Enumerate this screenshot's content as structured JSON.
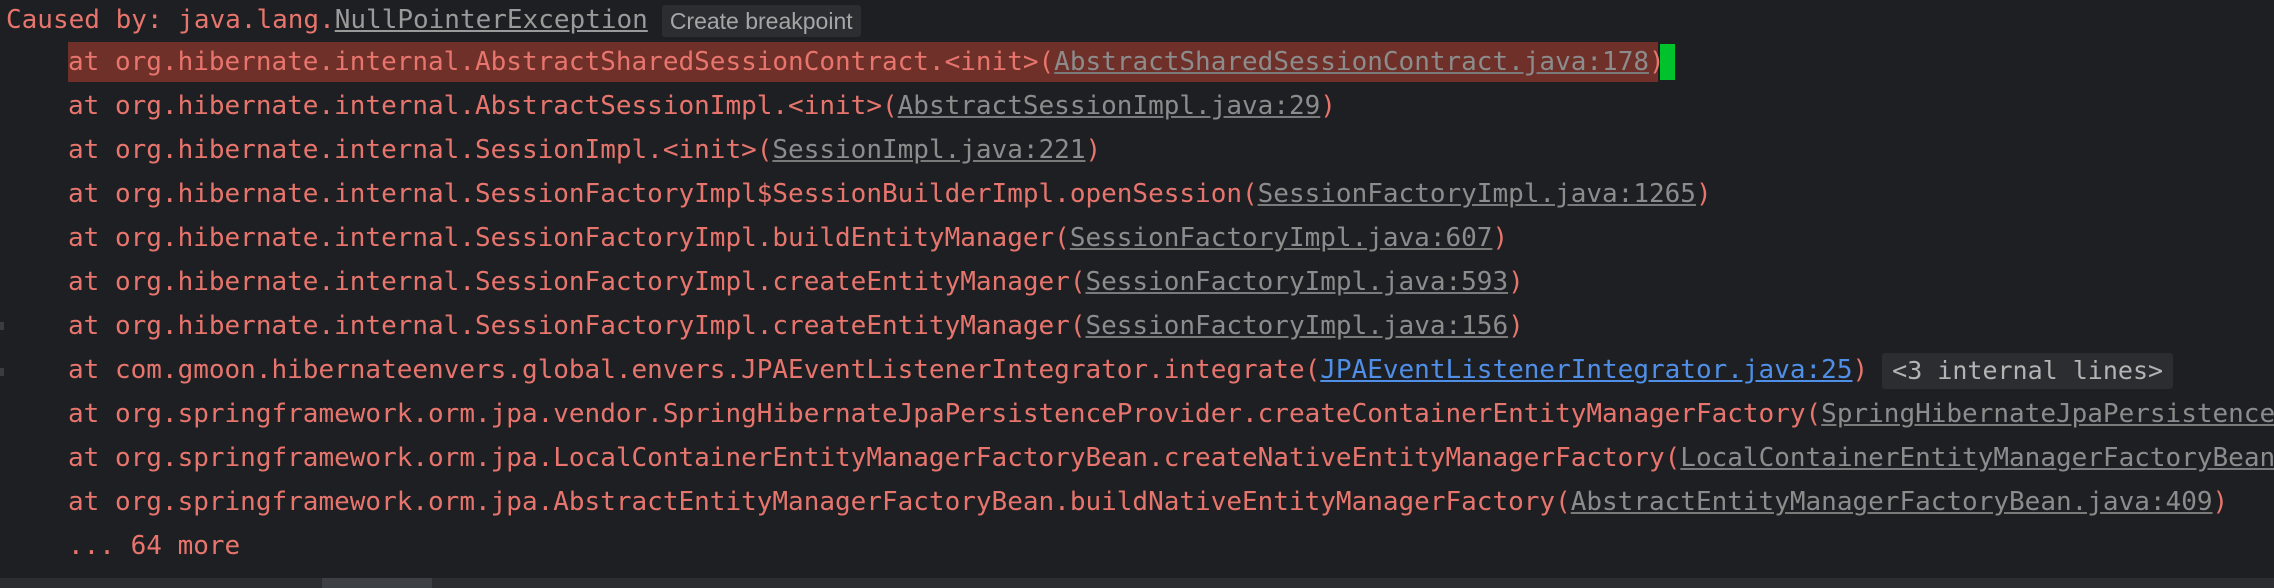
{
  "console": {
    "caused_prefix": "Caused by: java.lang.",
    "exception_name": "NullPointerException",
    "create_breakpoint": "Create breakpoint",
    "frames": [
      {
        "text": "at org.hibernate.internal.AbstractSharedSessionContract.<init>(",
        "link": "AbstractSharedSessionContract.java:178",
        "suffix": ")"
      },
      {
        "text": "at org.hibernate.internal.AbstractSessionImpl.<init>(",
        "link": "AbstractSessionImpl.java:29",
        "suffix": ")"
      },
      {
        "text": "at org.hibernate.internal.SessionImpl.<init>(",
        "link": "SessionImpl.java:221",
        "suffix": ")"
      },
      {
        "text": "at org.hibernate.internal.SessionFactoryImpl$SessionBuilderImpl.openSession(",
        "link": "SessionFactoryImpl.java:1265",
        "suffix": ")"
      },
      {
        "text": "at org.hibernate.internal.SessionFactoryImpl.buildEntityManager(",
        "link": "SessionFactoryImpl.java:607",
        "suffix": ")"
      },
      {
        "text": "at org.hibernate.internal.SessionFactoryImpl.createEntityManager(",
        "link": "SessionFactoryImpl.java:593",
        "suffix": ")"
      },
      {
        "text": "at org.hibernate.internal.SessionFactoryImpl.createEntityManager(",
        "link": "SessionFactoryImpl.java:156",
        "suffix": ")"
      },
      {
        "text": "at com.gmoon.hibernateenvers.global.envers.JPAEventListenerIntegrator.integrate(",
        "link": "JPAEventListenerIntegrator.java:25",
        "suffix": ")",
        "internal": "<3 internal lines>"
      },
      {
        "text": "at org.springframework.orm.jpa.vendor.SpringHibernateJpaPersistenceProvider.createContainerEntityManagerFactory(",
        "link": "SpringHibernateJpaPersistenceP",
        "suffix": ""
      },
      {
        "text": "at org.springframework.orm.jpa.LocalContainerEntityManagerFactoryBean.createNativeEntityManagerFactory(",
        "link": "LocalContainerEntityManagerFactoryBean.",
        "suffix": ""
      },
      {
        "text": "at org.springframework.orm.jpa.AbstractEntityManagerFactoryBean.buildNativeEntityManagerFactory(",
        "link": "AbstractEntityManagerFactoryBean.java:409",
        "suffix": ")"
      }
    ],
    "more": "... 64 more"
  },
  "colors": {
    "background": "#1e1f22",
    "error_text": "#e8756d",
    "highlight": "#6e3029",
    "caret": "#00c22a",
    "user_link": "#4f8fe8"
  }
}
